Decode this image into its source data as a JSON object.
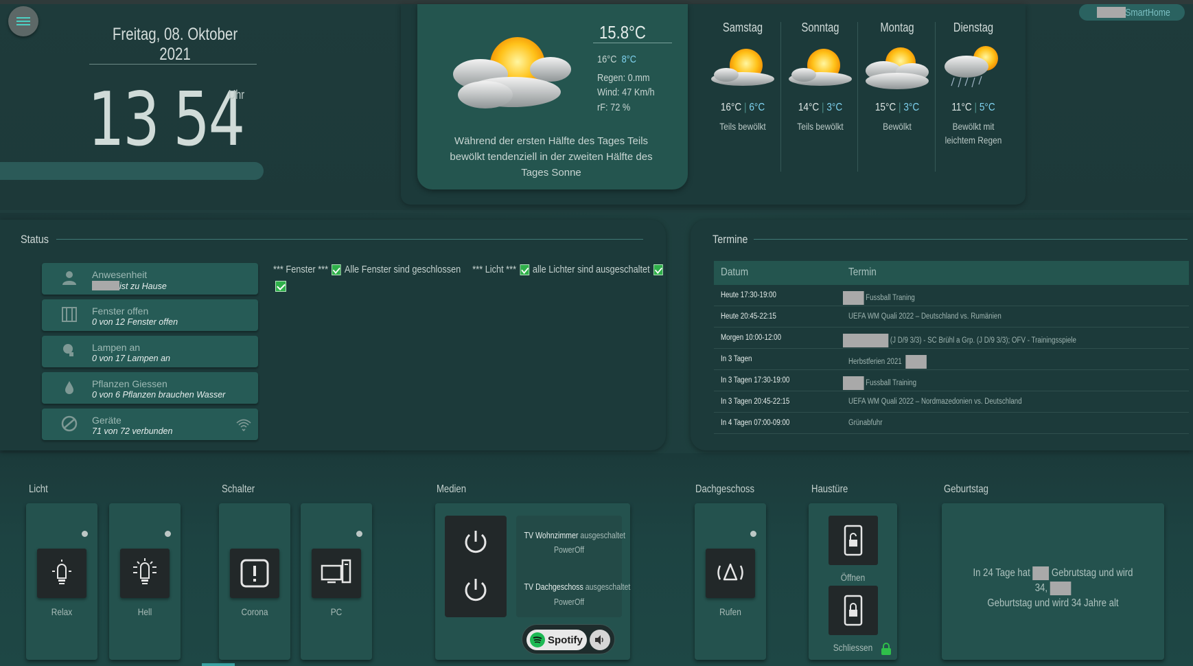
{
  "header": {
    "date": "Freitag, 08. Oktober 2021",
    "hour": "13",
    "minute": "54",
    "uhr": "Uhr",
    "smarthome_label": "SmartHome"
  },
  "weather": {
    "current_temp": "15.8°C",
    "high": "16°C",
    "low": "8°C",
    "rain": "Regen: 0.mm",
    "wind": "Wind: 47 Km/h",
    "humidity": "rF: 72 %",
    "description": "Während der ersten Hälfte des Tages Teils bewölkt tendenziell in der zweiten Hälfte des Tages Sonne",
    "forecast": [
      {
        "day": "Samstag",
        "high": "16°C",
        "low": "6°C",
        "desc": "Teils bewölkt",
        "icon": "partly-cloudy-icon"
      },
      {
        "day": "Sonntag",
        "high": "14°C",
        "low": "3°C",
        "desc": "Teils bewölkt",
        "icon": "partly-cloudy-icon"
      },
      {
        "day": "Montag",
        "high": "15°C",
        "low": "3°C",
        "desc": "Bewölkt",
        "icon": "cloudy-icon"
      },
      {
        "day": "Dienstag",
        "high": "11°C",
        "low": "5°C",
        "desc": "Bewölkt mit leichtem Regen",
        "icon": "light-rain-icon"
      }
    ]
  },
  "status": {
    "title": "Status",
    "cards": [
      {
        "title": "Anwesenheit",
        "subtitle": "ist zu Hause",
        "icon": "person-icon"
      },
      {
        "title": "Fenster offen",
        "subtitle": "0 von 12 Fenster offen",
        "icon": "window-icon"
      },
      {
        "title": "Lampen an",
        "subtitle": "0 von 17 Lampen an",
        "icon": "lamp-icon"
      },
      {
        "title": "Pflanzen Giessen",
        "subtitle": "0 von 6 Pflanzen brauchen Wasser",
        "icon": "water-drop-icon"
      },
      {
        "title": "Geräte",
        "subtitle": "71 von 72 verbunden",
        "icon": "devices-icon"
      }
    ],
    "checks": {
      "fenster_label": "*** Fenster ***",
      "fenster_text": "Alle Fenster sind geschlossen",
      "licht_label": "*** Licht ***",
      "licht_text": "alle Lichter sind ausgeschaltet"
    }
  },
  "termine": {
    "title": "Termine",
    "col_datum": "Datum",
    "col_termin": "Termin",
    "rows": [
      {
        "datum": "Heute 17:30-19:00",
        "termin": "Fussball Traning"
      },
      {
        "datum": "Heute 20:45-22:15",
        "termin": "UEFA WM Quali 2022 – Deutschland vs. Rumänien"
      },
      {
        "datum": "Morgen 10:00-12:00",
        "termin": "(J D/9 3/3) - SC Brühl a Grp. (J D/9 3/3); OFV - Trainingsspiele"
      },
      {
        "datum": "In 3 Tagen",
        "termin": "Herbstferien 2021"
      },
      {
        "datum": "In 3 Tagen 17:30-19:00",
        "termin": "Fussball Training"
      },
      {
        "datum": "In 3 Tagen 20:45-22:15",
        "termin": "UEFA WM Quali 2022 – Nordmazedonien vs. Deutschland"
      },
      {
        "datum": "In 4 Tagen 07:00-09:00",
        "termin": "Grünabfuhr"
      }
    ]
  },
  "bottom": {
    "licht": {
      "title": "Licht",
      "tiles": [
        {
          "label": "Relax"
        },
        {
          "label": "Hell"
        }
      ]
    },
    "schalter": {
      "title": "Schalter",
      "tiles": [
        {
          "label": "Corona"
        },
        {
          "label": "PC"
        }
      ]
    },
    "medien": {
      "title": "Medien",
      "tv1_name": "TV Wohnzimmer",
      "tv1_state": "ausgeschaltet",
      "tv1_power": "PowerOff",
      "tv2_name": "TV Dachgeschoss",
      "tv2_state": "ausgeschaltet",
      "tv2_power": "PowerOff",
      "spotify": "Spotify"
    },
    "dachgeschoss": {
      "title": "Dachgeschoss",
      "label": "Rufen"
    },
    "haustuer": {
      "title": "Haustüre",
      "open": "Öffnen",
      "close": "Schliessen"
    },
    "geburtstag": {
      "title": "Geburtstag",
      "line1a": "In 24 Tage hat",
      "line1b": "Gebrutstag und wird 34,",
      "line2": "Geburtstag und wird 34 Jahre alt"
    }
  }
}
